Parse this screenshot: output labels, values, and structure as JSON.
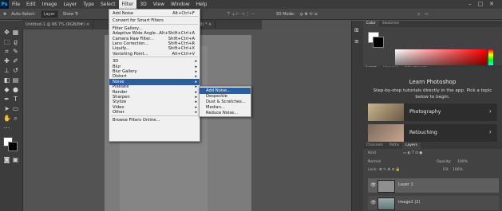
{
  "app": {
    "logo": "Ps"
  },
  "menubar": {
    "items": [
      "File",
      "Edit",
      "Image",
      "Layer",
      "Type",
      "Select",
      "Filter",
      "3D",
      "View",
      "Window",
      "Help"
    ],
    "active": "Filter",
    "window_controls": [
      "–",
      "□",
      "✕"
    ]
  },
  "options_bar": {
    "auto_select": "Auto-Select:",
    "layer_select": "Layer",
    "show_transform": "Show Tr",
    "mode_3d": "3D Mode:"
  },
  "document_tabs": [
    {
      "label": "Untitled-1 @ 66.7% (RGB/8#) ×",
      "active": false
    },
    {
      "label": "Layer 1, RGB/8) * ×",
      "active": true
    }
  ],
  "filter_menu": {
    "items": [
      {
        "label": "Add Noise",
        "shortcut": "Alt+Ctrl+F",
        "submenu": false
      },
      {
        "separator": true
      },
      {
        "label": "Convert for Smart Filters",
        "shortcut": "",
        "submenu": false
      },
      {
        "separator": true
      },
      {
        "label": "Filter Gallery...",
        "shortcut": "",
        "submenu": false
      },
      {
        "label": "Adaptive Wide Angle...",
        "shortcut": "Alt+Shift+Ctrl+A",
        "submenu": false
      },
      {
        "label": "Camera Raw Filter...",
        "shortcut": "Shift+Ctrl+A",
        "submenu": false
      },
      {
        "label": "Lens Correction...",
        "shortcut": "Shift+Ctrl+R",
        "submenu": false
      },
      {
        "label": "Liquify...",
        "shortcut": "Shift+Ctrl+X",
        "submenu": false
      },
      {
        "label": "Vanishing Point...",
        "shortcut": "Alt+Ctrl+V",
        "submenu": false
      },
      {
        "separator": true
      },
      {
        "label": "3D",
        "shortcut": "",
        "submenu": true
      },
      {
        "label": "Blur",
        "shortcut": "",
        "submenu": true
      },
      {
        "label": "Blur Gallery",
        "shortcut": "",
        "submenu": true
      },
      {
        "label": "Distort",
        "shortcut": "",
        "submenu": true
      },
      {
        "label": "Noise",
        "shortcut": "",
        "submenu": true,
        "highlighted": true
      },
      {
        "label": "Pixelate",
        "shortcut": "",
        "submenu": true
      },
      {
        "label": "Render",
        "shortcut": "",
        "submenu": true
      },
      {
        "label": "Sharpen",
        "shortcut": "",
        "submenu": true
      },
      {
        "label": "Stylize",
        "shortcut": "",
        "submenu": true
      },
      {
        "label": "Video",
        "shortcut": "",
        "submenu": true
      },
      {
        "label": "Other",
        "shortcut": "",
        "submenu": true
      },
      {
        "separator": true
      },
      {
        "label": "Browse Filters Online...",
        "shortcut": "",
        "submenu": false
      }
    ]
  },
  "noise_submenu": {
    "items": [
      {
        "label": "Add Noise...",
        "highlighted": true
      },
      {
        "label": "Despeckle",
        "highlighted": false
      },
      {
        "label": "Dust & Scratches...",
        "highlighted": false
      },
      {
        "label": "Median...",
        "highlighted": false
      },
      {
        "label": "Reduce Noise...",
        "highlighted": false
      }
    ]
  },
  "right_panel": {
    "color_tabs": [
      "Color",
      "Swatches"
    ],
    "learn_tabs": [
      "Learn",
      "Libraries",
      "Adjustments"
    ],
    "learn_title": "Learn Photoshop",
    "learn_desc": "Step-by-step tutorials directly in the app. Pick a topic below to begin.",
    "cards": [
      "Photography",
      "Retouching"
    ],
    "layer_tabs": [
      "Channels",
      "Paths",
      "Layers"
    ],
    "kind_label": "Kind",
    "blend_mode": "Normal",
    "opacity_label": "Opacity:",
    "opacity_value": "100%",
    "lock_label": "Lock:",
    "fill_label": "Fill:",
    "fill_value": "100%",
    "layers": [
      {
        "name": "Layer 1",
        "selected": true
      },
      {
        "name": "image1 (2)",
        "selected": false
      }
    ]
  },
  "colors": {
    "highlight": "#2c5d9c",
    "menu_bg": "#f0f0f0",
    "ui_dark": "#3b3b3b"
  }
}
